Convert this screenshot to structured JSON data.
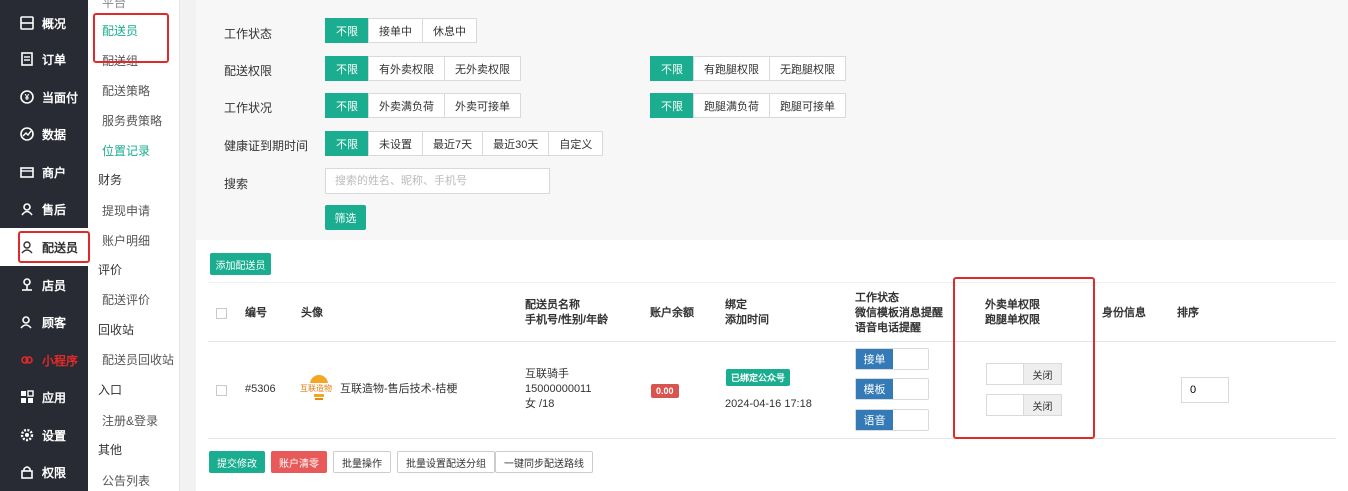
{
  "sidebar": {
    "top_partial": "平台",
    "items": [
      {
        "label": "概况",
        "icon": "overview-icon"
      },
      {
        "label": "订单",
        "icon": "order-icon"
      },
      {
        "label": "当面付",
        "icon": "pay-icon"
      },
      {
        "label": "数据",
        "icon": "data-icon"
      },
      {
        "label": "商户",
        "icon": "shop-icon"
      },
      {
        "label": "售后",
        "icon": "aftersale-icon"
      },
      {
        "label": "配送员",
        "icon": "user-icon"
      },
      {
        "label": "店员",
        "icon": "clerk-icon"
      },
      {
        "label": "顾客",
        "icon": "customer-icon"
      },
      {
        "label": "小程序",
        "icon": "miniapp-icon"
      },
      {
        "label": "应用",
        "icon": "apps-icon"
      },
      {
        "label": "设置",
        "icon": "gear-icon"
      },
      {
        "label": "权限",
        "icon": "lock-icon"
      }
    ]
  },
  "subnav": {
    "items": [
      {
        "label": "配送员",
        "type": "active"
      },
      {
        "label": "配送组",
        "type": "item"
      },
      {
        "label": "配送策略",
        "type": "item"
      },
      {
        "label": "服务费策略",
        "type": "item"
      },
      {
        "label": "位置记录",
        "type": "green"
      },
      {
        "label": "财务",
        "type": "group"
      },
      {
        "label": "提现申请",
        "type": "item"
      },
      {
        "label": "账户明细",
        "type": "item"
      },
      {
        "label": "评价",
        "type": "group"
      },
      {
        "label": "配送评价",
        "type": "item"
      },
      {
        "label": "回收站",
        "type": "group"
      },
      {
        "label": "配送员回收站",
        "type": "item"
      },
      {
        "label": "入口",
        "type": "group"
      },
      {
        "label": "注册&登录",
        "type": "item"
      },
      {
        "label": "其他",
        "type": "group"
      },
      {
        "label": "公告列表",
        "type": "item"
      }
    ]
  },
  "filters": {
    "work_status": {
      "label": "工作状态",
      "options": [
        "不限",
        "接单中",
        "休息中"
      ]
    },
    "perm": {
      "label": "配送权限",
      "options_a": [
        "不限",
        "有外卖权限",
        "无外卖权限"
      ],
      "options_b": [
        "不限",
        "有跑腿权限",
        "无跑腿权限"
      ]
    },
    "work_cond": {
      "label": "工作状况",
      "options_a": [
        "不限",
        "外卖满负荷",
        "外卖可接单"
      ],
      "options_b": [
        "不限",
        "跑腿满负荷",
        "跑腿可接单"
      ]
    },
    "health": {
      "label": "健康证到期时间",
      "options": [
        "不限",
        "未设置",
        "最近7天",
        "最近30天",
        "自定义"
      ]
    },
    "search": {
      "label": "搜索",
      "placeholder": "搜索的姓名、昵称、手机号"
    },
    "filter_button": "筛选"
  },
  "add_button": "添加配送员",
  "table": {
    "headers": {
      "id": "编号",
      "avatar": "头像",
      "name_1": "配送员名称",
      "name_2": "手机号/性别/年龄",
      "balance": "账户余额",
      "bind_1": "绑定",
      "bind_2": "添加时间",
      "status_1": "工作状态",
      "status_2": "微信模板消息提醒",
      "status_3": "语音电话提醒",
      "perm_1": "外卖单权限",
      "perm_2": "跑腿单权限",
      "identity": "身份信息",
      "sort": "排序"
    },
    "row": {
      "id": "#5306",
      "avatar_logo": "互联造物",
      "avatar_name": "互联造物-售后技术-桔梗",
      "name": "互联骑手",
      "phone": "15000000011",
      "gender_age": "女 /18",
      "balance": "0.00",
      "bind_badge": "已绑定公众号",
      "add_time": "2024-04-16 17:18",
      "toggle_order": "接单",
      "toggle_template": "模板",
      "toggle_voice": "语音",
      "switch_takeout": "关闭",
      "switch_errand": "关闭",
      "sort": "0"
    }
  },
  "footer_buttons": {
    "submit": "提交修改",
    "clear": "账户清零",
    "batch": "批量操作",
    "batch_group": "批量设置配送分组",
    "sync": "一键同步配送路线"
  },
  "colors": {
    "accent": "#1aad8f",
    "sidebar": "#282b33",
    "highlight": "#e02a2a",
    "toggle": "#337ab7"
  }
}
